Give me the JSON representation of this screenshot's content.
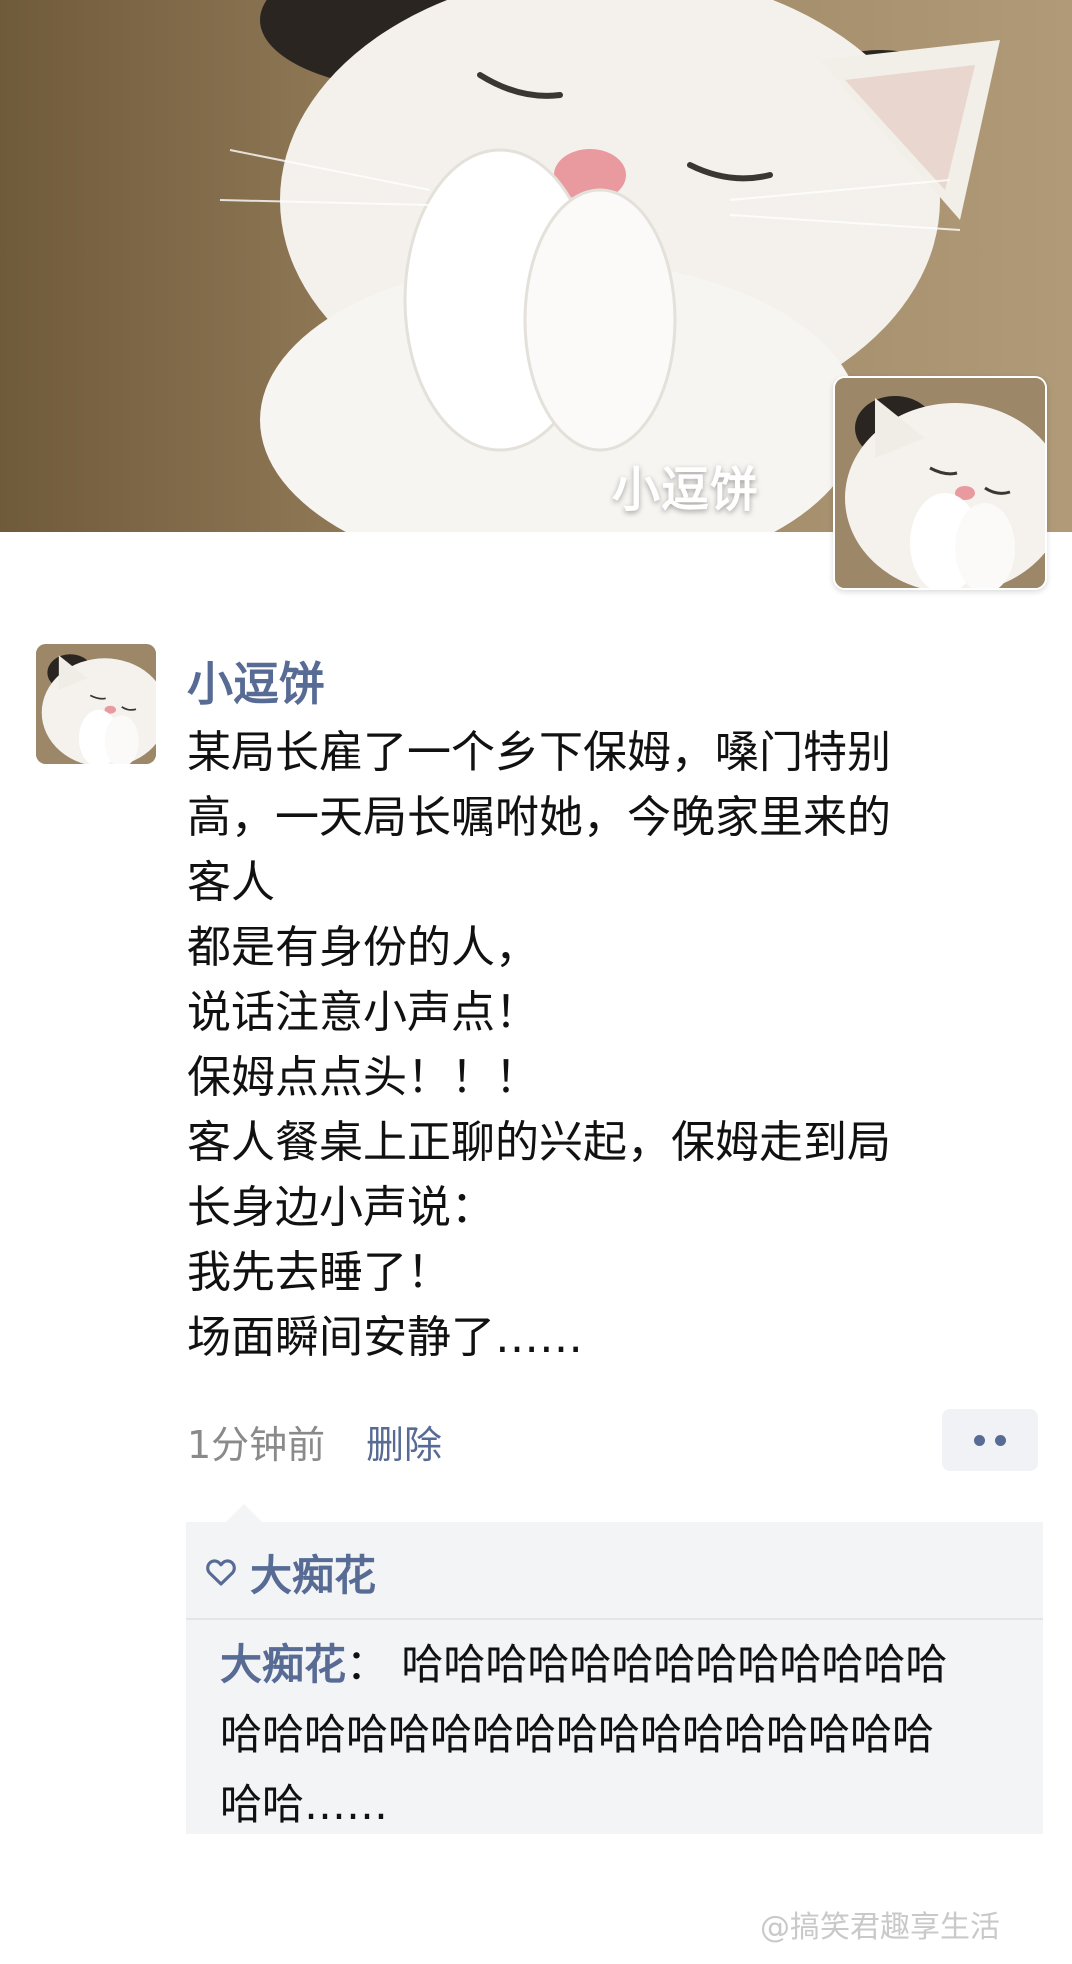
{
  "cover": {
    "name": "小逗饼"
  },
  "post": {
    "author": "小逗饼",
    "lines": [
      "某局长雇了一个乡下保姆，嗓门特别",
      "高，一天局长嘱咐她，今晚家里来的",
      "客人",
      "都是有身份的人，",
      "说话注意小声点！",
      "保姆点点头！！！",
      "客人餐桌上正聊的兴起，保姆走到局",
      "长身边小声说：",
      "我先去睡了！",
      "场面瞬间安静了……"
    ],
    "time": "1分钟前",
    "delete_label": "删除",
    "more_icon": "more-dots-icon"
  },
  "likes": {
    "icon": "heart-outline-icon",
    "names": "大痴花"
  },
  "comment": {
    "author": "大痴花",
    "separator": "：",
    "line1": "哈哈哈哈哈哈哈哈哈哈哈哈哈",
    "line2": "哈哈哈哈哈哈哈哈哈哈哈哈哈哈哈哈哈",
    "line3": "哈哈……"
  },
  "watermark": "@搞笑君趣享生活",
  "colors": {
    "link": "#576b95",
    "text": "#111111",
    "muted": "#8a8a8a",
    "panel": "#f3f4f6"
  }
}
